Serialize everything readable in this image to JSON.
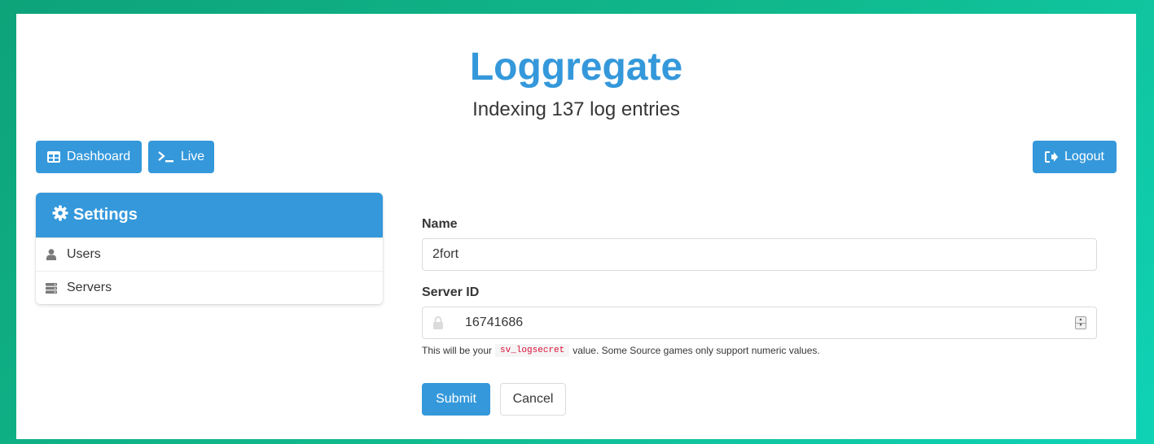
{
  "header": {
    "title": "Loggregate",
    "subtitle": "Indexing 137 log entries"
  },
  "nav": {
    "dashboard_label": "Dashboard",
    "live_label": "Live",
    "logout_label": "Logout"
  },
  "sidebar": {
    "heading": "Settings",
    "items": [
      {
        "label": "Users",
        "icon": "user-icon"
      },
      {
        "label": "Servers",
        "icon": "server-icon"
      }
    ]
  },
  "form": {
    "name_label": "Name",
    "name_value": "2fort",
    "server_id_label": "Server ID",
    "server_id_value": "16741686",
    "help_prefix": "This will be your",
    "help_code": "sv_logsecret",
    "help_suffix": "value. Some Source games only support numeric values.",
    "submit_label": "Submit",
    "cancel_label": "Cancel"
  },
  "colors": {
    "accent": "#3498db",
    "background_start": "#0ea37a",
    "background_end": "#0fd3b6",
    "code_text": "#da1039"
  }
}
